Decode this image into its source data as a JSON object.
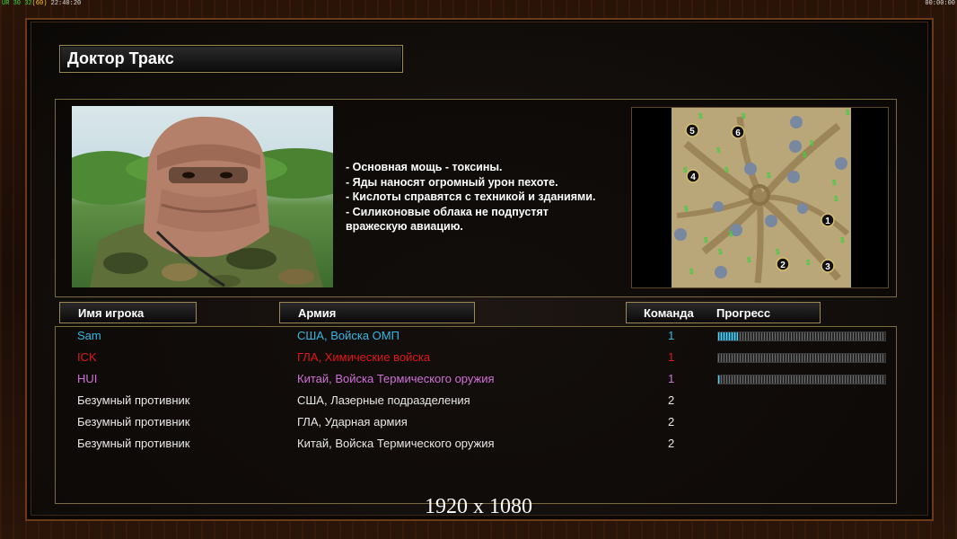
{
  "overlay": {
    "status_left_a": "UR 30 32",
    "status_left_b": "(60)",
    "status_left_c": "22:40:20",
    "status_right": "00:00:00"
  },
  "general": {
    "name": "Доктор Тракс",
    "description": [
      "- Основная мощь - токсины.",
      "- Яды наносят огромный урон пехоте.",
      "- Кислоты справятся с техникой и зданиями.",
      "- Силиконовые облака не подпустят",
      " вражескую авиацию."
    ]
  },
  "minimap": {
    "start_positions": [
      "5",
      "6",
      "4",
      "1",
      "2",
      "3"
    ]
  },
  "table": {
    "headers": {
      "player": "Имя игрока",
      "army": "Армия",
      "team": "Команда",
      "progress": "Прогресс"
    },
    "rows": [
      {
        "name": "Sam",
        "army": "США, Войска ОМП",
        "team": "1",
        "color": "#35b8e6",
        "progress": 0.12
      },
      {
        "name": "ICK",
        "army": "ГЛА, Химические войска",
        "team": "1",
        "color": "#e01818",
        "progress": 0.0
      },
      {
        "name": "HUI",
        "army": "Китай, Войска Термического оружия",
        "team": "1",
        "color": "#d070d8",
        "progress": 0.01
      },
      {
        "name": "Безумный противник",
        "army": "США, Лазерные подразделения",
        "team": "2",
        "color": "#e8e8e8",
        "progress": null
      },
      {
        "name": "Безумный противник",
        "army": "ГЛА, Ударная армия",
        "team": "2",
        "color": "#e8e8e8",
        "progress": null
      },
      {
        "name": "Безумный противник",
        "army": "Китай, Войска Термического оружия",
        "team": "2",
        "color": "#e8e8e8",
        "progress": null
      }
    ]
  },
  "watermark": "1920 x 1080",
  "colors": {
    "frame": "#6b3a1a",
    "panel_border": "#7a6a40",
    "progress_fill": "#5fd0f0"
  }
}
